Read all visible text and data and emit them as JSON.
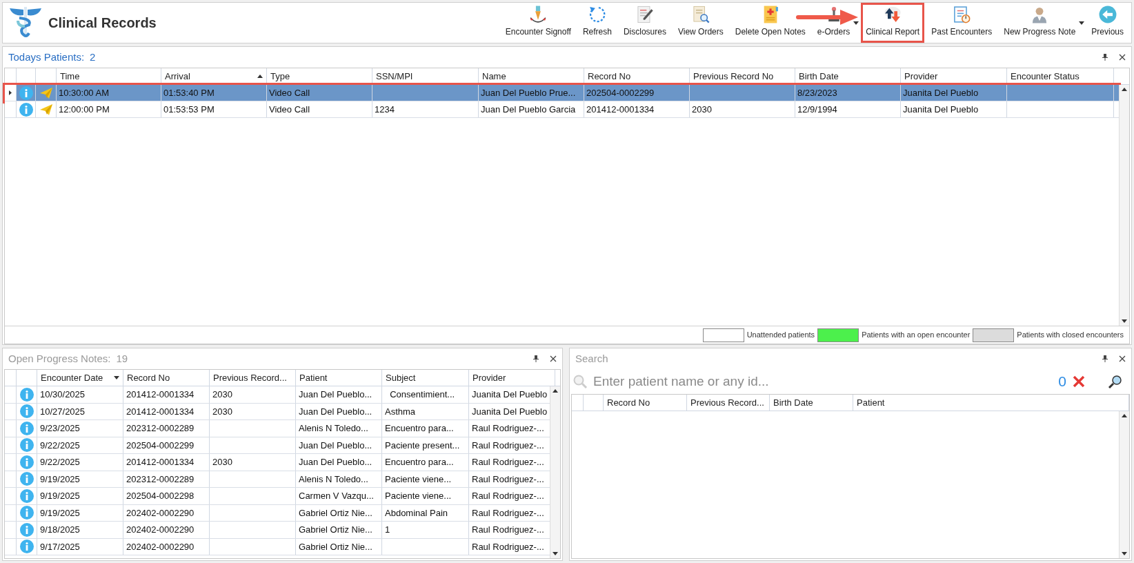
{
  "app": {
    "title": "Clinical Records"
  },
  "toolbar": [
    {
      "label": "Encounter Signoff",
      "highlighted": false,
      "dropdown": false
    },
    {
      "label": "Refresh",
      "highlighted": false,
      "dropdown": false
    },
    {
      "label": "Disclosures",
      "highlighted": false,
      "dropdown": false
    },
    {
      "label": "View Orders",
      "highlighted": false,
      "dropdown": false
    },
    {
      "label": "Delete Open Notes",
      "highlighted": false,
      "dropdown": false
    },
    {
      "label": "e-Orders",
      "highlighted": false,
      "dropdown": true
    },
    {
      "label": "Clinical Report",
      "highlighted": true,
      "dropdown": false
    },
    {
      "label": "Past Encounters",
      "highlighted": false,
      "dropdown": false
    },
    {
      "label": "New Progress Note",
      "highlighted": false,
      "dropdown": true
    },
    {
      "label": "Previous",
      "highlighted": false,
      "dropdown": false
    }
  ],
  "todays_patients": {
    "title": "Todays Patients:",
    "count": "2",
    "active": true,
    "columns": [
      {
        "label": "Time"
      },
      {
        "label": "Arrival",
        "sorted_ascending": true
      },
      {
        "label": "Type"
      },
      {
        "label": "SSN/MPI"
      },
      {
        "label": "Name"
      },
      {
        "label": "Record No"
      },
      {
        "label": "Previous Record No"
      },
      {
        "label": "Birth Date"
      },
      {
        "label": "Provider"
      },
      {
        "label": "Encounter Status"
      }
    ],
    "rows": [
      {
        "selected": true,
        "highlighted": true,
        "cells": [
          "10:30:00 AM",
          "01:53:40 PM",
          "Video Call",
          "",
          "Juan Del Pueblo Prue...",
          "202504-0002299",
          "",
          "8/23/2023",
          "Juanita Del Pueblo",
          ""
        ]
      },
      {
        "selected": false,
        "highlighted": false,
        "cells": [
          "12:00:00 PM",
          "01:53:53 PM",
          "Video Call",
          "1234",
          "Juan Del Pueblo Garcia",
          "201412-0001334",
          "2030",
          "12/9/1994",
          "Juanita Del Pueblo",
          ""
        ]
      }
    ],
    "legend": [
      {
        "label": "Unattended patients",
        "color": "#ffffff"
      },
      {
        "label": "Patients with an open encounter",
        "color": "#4cf04c"
      },
      {
        "label": "Patients with closed encounters",
        "color": "#dcdcdc"
      }
    ]
  },
  "open_progress_notes": {
    "title": "Open Progress Notes:",
    "count": "19",
    "active": false,
    "columns": [
      {
        "label": "Encounter Date",
        "sorted_descending": true
      },
      {
        "label": "Record No"
      },
      {
        "label": "Previous Record..."
      },
      {
        "label": "Patient"
      },
      {
        "label": "Subject"
      },
      {
        "label": "Provider"
      }
    ],
    "rows": [
      [
        "10/30/2025",
        "201412-0001334",
        "2030",
        "Juan Del Pueblo...",
        "  Consentimient...",
        "Juanita Del Pueblo"
      ],
      [
        "10/27/2025",
        "201412-0001334",
        "2030",
        "Juan Del Pueblo...",
        "Asthma",
        "Juanita Del Pueblo"
      ],
      [
        "9/23/2025",
        "202312-0002289",
        "",
        "Alenis N Toledo...",
        "Encuentro para...",
        "Raul Rodriguez-..."
      ],
      [
        "9/22/2025",
        "202504-0002299",
        "",
        "Juan Del Pueblo...",
        "Paciente present...",
        "Raul Rodriguez-..."
      ],
      [
        "9/22/2025",
        "201412-0001334",
        "2030",
        "Juan Del Pueblo...",
        "Encuentro para...",
        "Raul Rodriguez-..."
      ],
      [
        "9/19/2025",
        "202312-0002289",
        "",
        "Alenis N Toledo...",
        "Paciente viene...",
        "Raul Rodriguez-..."
      ],
      [
        "9/19/2025",
        "202504-0002298",
        "",
        "Carmen V Vazqu...",
        "Paciente viene...",
        "Raul Rodriguez-..."
      ],
      [
        "9/19/2025",
        "202402-0002290",
        "",
        "Gabriel Ortiz Nie...",
        "Abdominal Pain",
        "Raul Rodriguez-..."
      ],
      [
        "9/18/2025",
        "202402-0002290",
        "",
        "Gabriel Ortiz Nie...",
        "1",
        "Raul Rodriguez-..."
      ],
      [
        "9/17/2025",
        "202402-0002290",
        "",
        "Gabriel Ortiz Nie...",
        "",
        "Raul Rodriguez-..."
      ]
    ]
  },
  "search": {
    "title": "Search",
    "active": false,
    "placeholder": "Enter patient name or any id...",
    "result_count": "0",
    "columns": [
      "Record No",
      "Previous Record...",
      "Birth Date",
      "Patient"
    ]
  }
}
